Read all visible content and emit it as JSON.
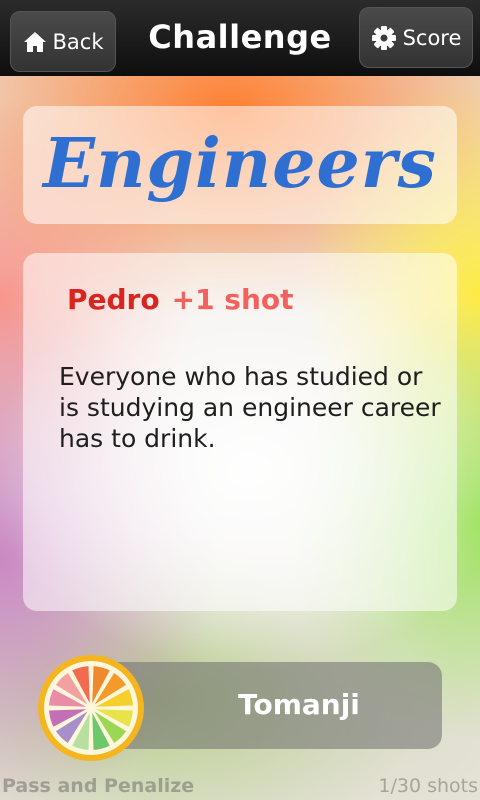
{
  "header": {
    "back_label": "Back",
    "title": "Challenge",
    "score_label": "Score"
  },
  "card": {
    "category": "Engineers",
    "player": "Pedro",
    "penalty": "+1 shot",
    "text": "Everyone who has studied or is studying an engineer career has to drink."
  },
  "action": {
    "label": "Tomanji"
  },
  "footer": {
    "pass_label": "Pass and Penalize",
    "shots_count": "1/30 shots"
  },
  "icons": {
    "back": "home-icon",
    "score": "gear-icon",
    "logo": "citrus-slice-icon"
  },
  "colors": {
    "category": "#2f6fd1",
    "player": "#d8261f",
    "penalty": "#f2615e"
  }
}
